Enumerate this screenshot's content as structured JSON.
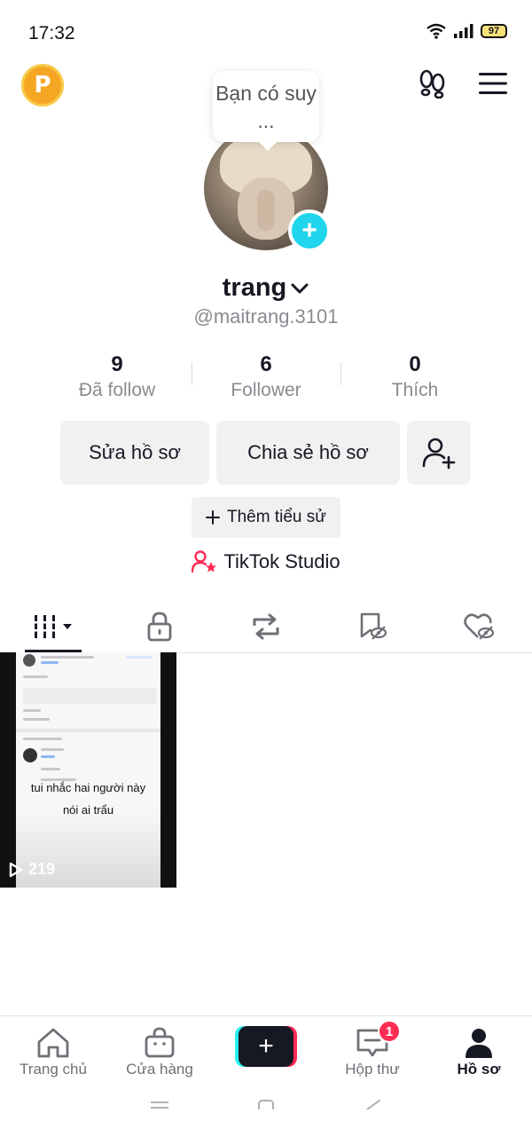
{
  "status_bar": {
    "time": "17:32",
    "battery": "97"
  },
  "points_badge": {
    "letter": "P"
  },
  "profile": {
    "note_bubble": "Bạn có suy ...",
    "display_name": "trang",
    "handle": "@maitrang.3101",
    "avatar_add_symbol": "+"
  },
  "stats": [
    {
      "value": "9",
      "label": "Đã follow"
    },
    {
      "value": "6",
      "label": "Follower"
    },
    {
      "value": "0",
      "label": "Thích"
    }
  ],
  "buttons": {
    "edit_profile": "Sửa hồ sơ",
    "share_profile": "Chia sẻ hồ sơ",
    "add_bio": "Thêm tiểu sử",
    "tiktok_studio": "TikTok Studio"
  },
  "tabs": [
    {
      "icon": "grid-icon",
      "active": true
    },
    {
      "icon": "lock-icon",
      "active": false
    },
    {
      "icon": "repost-icon",
      "active": false
    },
    {
      "icon": "bookmark-icon",
      "active": false
    },
    {
      "icon": "liked-hidden-icon",
      "active": false
    }
  ],
  "videos": [
    {
      "caption_line1": "tui nhắc hai người này",
      "caption_line2": "nói ai trẩu",
      "views": "219"
    }
  ],
  "bottom_nav": [
    {
      "label": "Trang chủ",
      "icon": "home-icon"
    },
    {
      "label": "Cửa hàng",
      "icon": "shop-icon"
    },
    {
      "label": "",
      "icon": "create-icon"
    },
    {
      "label": "Hộp thư",
      "icon": "inbox-icon",
      "badge": "1"
    },
    {
      "label": "Hồ sơ",
      "icon": "profile-icon",
      "active": true
    }
  ],
  "colors": {
    "accent_cyan": "#20d5ec",
    "accent_red": "#fe2c55",
    "text_primary": "#161823",
    "text_secondary": "#8a8b91",
    "button_bg": "#f1f1f2"
  }
}
